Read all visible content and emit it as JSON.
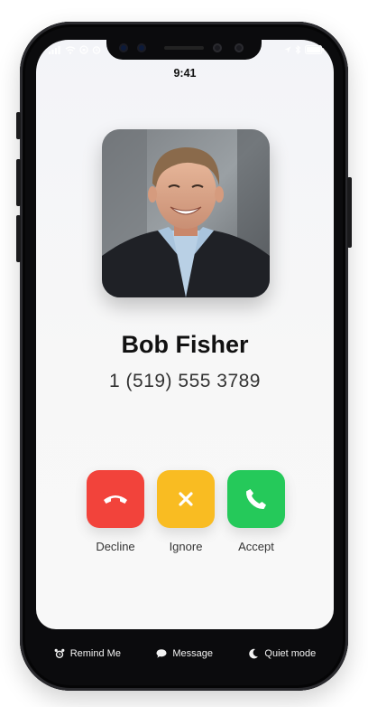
{
  "status_bar": {
    "time": "9:41"
  },
  "caller": {
    "name": "Bob Fisher",
    "number": "1 (519) 555 3789"
  },
  "actions": {
    "decline_label": "Decline",
    "ignore_label": "Ignore",
    "accept_label": "Accept"
  },
  "bottom_bar": {
    "remind_label": "Remind Me",
    "message_label": "Message",
    "quiet_label": "Quiet mode"
  },
  "colors": {
    "decline": "#f2433b",
    "ignore": "#f9bc22",
    "accept": "#25c95a"
  },
  "icons": {
    "decline": "phone-hangup-icon",
    "ignore": "x-icon",
    "accept": "phone-icon",
    "remind": "alarm-clock-icon",
    "message": "speech-bubble-icon",
    "quiet": "moon-icon"
  }
}
